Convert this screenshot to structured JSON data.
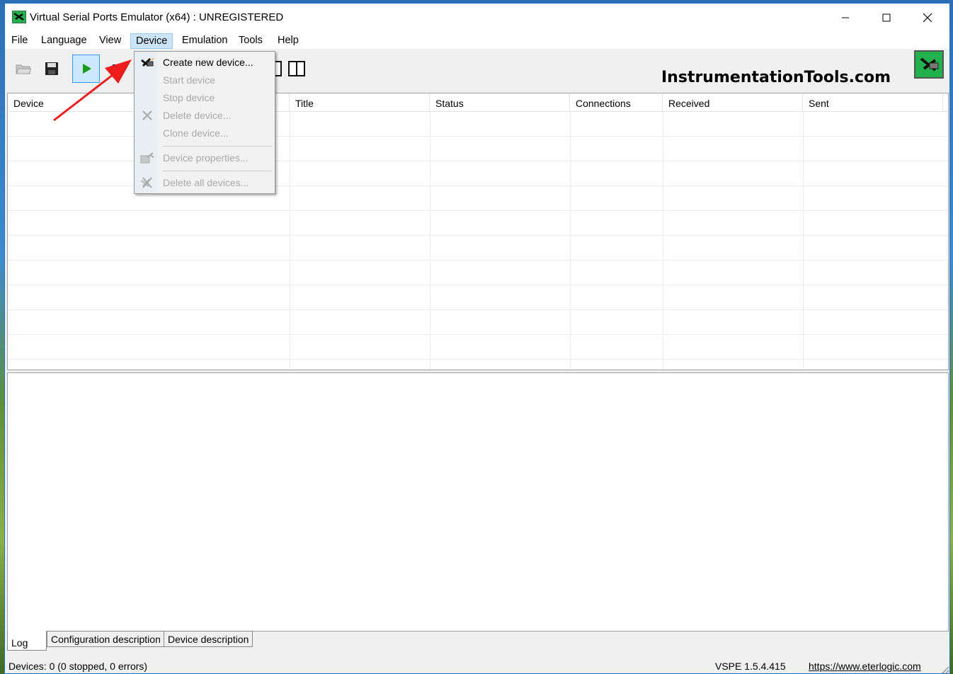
{
  "window": {
    "title": "Virtual Serial Ports Emulator (x64) : UNREGISTERED"
  },
  "menu": {
    "items": [
      "File",
      "Language",
      "View",
      "Device",
      "Emulation",
      "Tools",
      "Help"
    ],
    "active": "Device"
  },
  "device_menu": {
    "items": [
      {
        "label": "Create new device...",
        "enabled": true,
        "icon": "create-device-icon"
      },
      {
        "label": "Start device",
        "enabled": false
      },
      {
        "label": "Stop device",
        "enabled": false
      },
      {
        "label": "Delete device...",
        "enabled": false,
        "icon": "delete-icon"
      },
      {
        "label": "Clone device...",
        "enabled": false
      },
      {
        "label": "Device properties...",
        "enabled": false,
        "icon": "properties-icon"
      },
      {
        "label": "Delete all devices...",
        "enabled": false,
        "icon": "delete-all-icon"
      }
    ]
  },
  "toolbar": {
    "brand": "InstrumentationTools.com"
  },
  "device_list": {
    "columns": [
      "Device",
      "Title",
      "Status",
      "Connections",
      "Received",
      "Sent"
    ],
    "rows": []
  },
  "tabs": [
    "Log",
    "Configuration description",
    "Device description"
  ],
  "selected_tab": "Log",
  "status": {
    "text": "Devices: 0 (0 stopped, 0 errors)",
    "version": "VSPE 1.5.4.415",
    "link": "https://www.eterlogic.com"
  },
  "colors": {
    "window_border": "#1a73c8",
    "menu_highlight": "#cce4f7",
    "play_green": "#1a9a1a",
    "annotation_arrow": "#ee1c1c"
  }
}
